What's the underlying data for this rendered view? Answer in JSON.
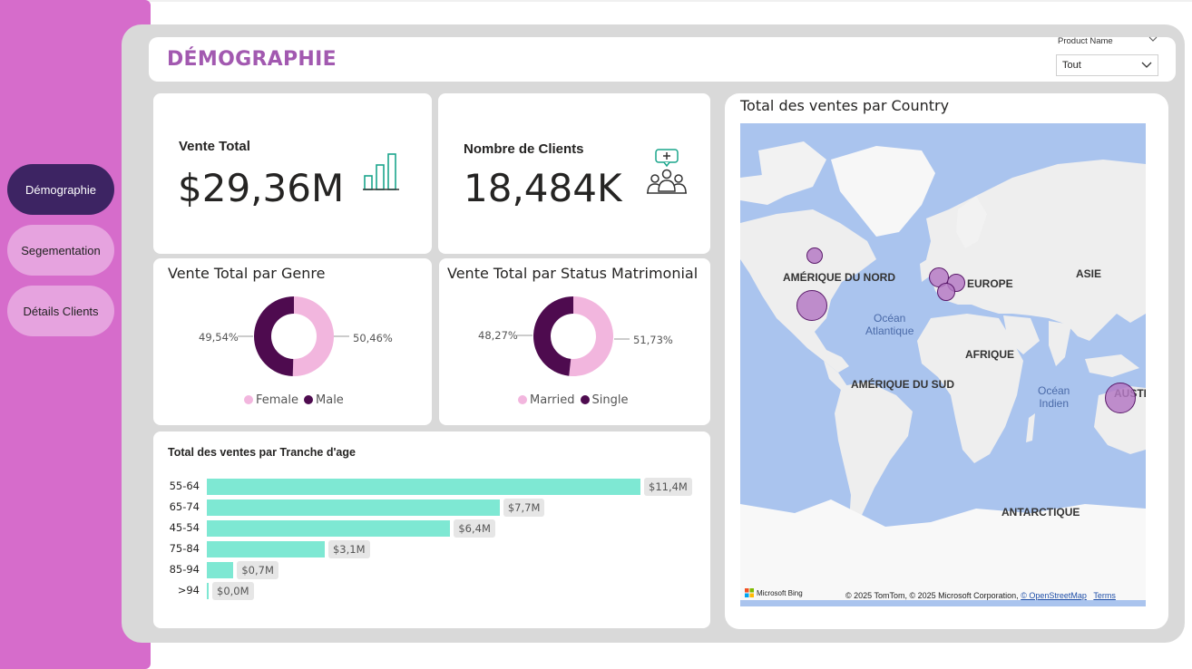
{
  "nav": {
    "items": [
      {
        "label": "Démographie",
        "active": true
      },
      {
        "label": "Segementation",
        "active": false
      },
      {
        "label": "Détails Clients",
        "active": false
      }
    ]
  },
  "header": {
    "title": "DÉMOGRAPHIE",
    "slicer": {
      "label": "Product Name",
      "value": "Tout"
    }
  },
  "kpi": {
    "sales": {
      "label": "Vente Total",
      "value": "$29,36M",
      "icon": "bar-chart-icon"
    },
    "clients": {
      "label": "Nombre de Clients",
      "value": "18,484K",
      "icon": "customers-icon"
    }
  },
  "gender_chart": {
    "title": "Vente Total par Genre",
    "left_pct": "49,54%",
    "right_pct": "50,46%",
    "legend": [
      "Female",
      "Male"
    ],
    "shares": [
      50.46,
      49.54
    ],
    "colors": [
      "#f2b6de",
      "#4e0b4f"
    ]
  },
  "marital_chart": {
    "title": "Vente Total par Status Matrimonial",
    "left_pct": "48,27%",
    "right_pct": "51,73%",
    "legend": [
      "Married",
      "Single"
    ],
    "shares": [
      51.73,
      48.27
    ],
    "colors": [
      "#f2b6de",
      "#4e0b4f"
    ]
  },
  "chart_data": {
    "type": "bar",
    "title": "Total des ventes par Tranche d'age",
    "categories": [
      "55-64",
      "65-74",
      "45-54",
      "75-84",
      "85-94",
      ">94"
    ],
    "values": [
      11.4,
      7.7,
      6.4,
      3.1,
      0.7,
      0.0
    ],
    "labels": [
      "$11,4M",
      "$7,7M",
      "$6,4M",
      "$3,1M",
      "$0,7M",
      "$0,0M"
    ],
    "unit": "$M",
    "orientation": "horizontal",
    "color": "#7ee8d3"
  },
  "map": {
    "title": "Total des ventes par Country",
    "labels": {
      "north_america": "AMÉRIQUE DU NORD",
      "europe": "EUROPE",
      "asia": "ASIE",
      "africa": "AFRIQUE",
      "south_america": "AMÉRIQUE DU SUD",
      "australia": "AUSTR",
      "antarctica": "ANTARCTIQUE",
      "atlantic_1": "Océan",
      "atlantic_2": "Atlantique",
      "indian_1": "Océan",
      "indian_2": "Indien"
    },
    "attribution": {
      "brand": "Microsoft Bing",
      "text": "© 2025 TomTom, © 2025 Microsoft Corporation,",
      "osm": "© OpenStreetMap",
      "terms": "Terms"
    }
  }
}
